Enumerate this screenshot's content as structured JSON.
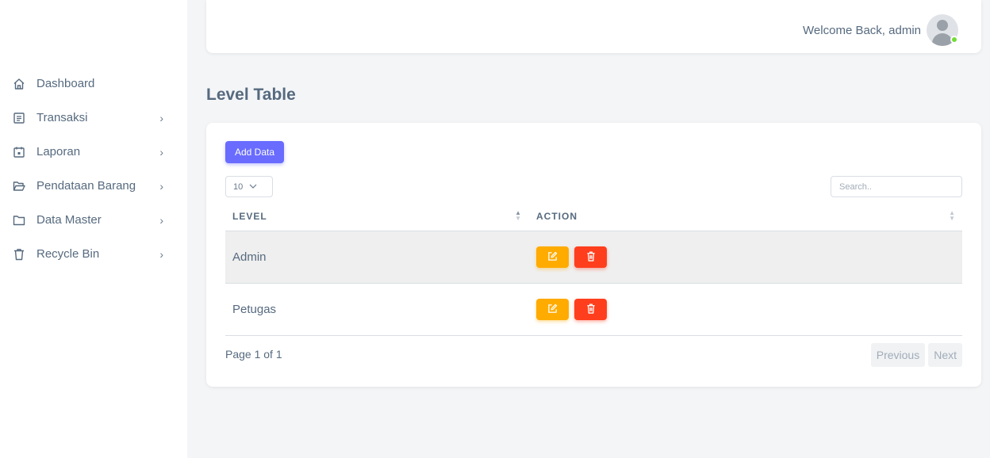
{
  "sidebar": {
    "items": [
      {
        "label": "Dashboard",
        "icon": "home-icon",
        "has_chevron": false
      },
      {
        "label": "Transaksi",
        "icon": "receipt-icon",
        "has_chevron": true
      },
      {
        "label": "Laporan",
        "icon": "calendar-icon",
        "has_chevron": true
      },
      {
        "label": "Pendataan Barang",
        "icon": "folder-open-icon",
        "has_chevron": true
      },
      {
        "label": "Data Master",
        "icon": "folder-icon",
        "has_chevron": true
      },
      {
        "label": "Recycle Bin",
        "icon": "trash-icon",
        "has_chevron": true
      }
    ],
    "chevron": "›"
  },
  "header": {
    "welcome": "Welcome Back, admin",
    "avatar_status_color": "#71dd37"
  },
  "page": {
    "title": "Level Table"
  },
  "table_controls": {
    "add_label": "Add Data",
    "page_size": "10",
    "search_placeholder": "Search.."
  },
  "table": {
    "columns": [
      "LEVEL",
      "ACTION"
    ],
    "rows": [
      {
        "level": "Admin"
      },
      {
        "level": "Petugas"
      }
    ]
  },
  "pagination": {
    "info": "Page 1 of 1",
    "previous": "Previous",
    "next": "Next"
  },
  "colors": {
    "primary": "#696cff",
    "warning": "#ffab00",
    "danger": "#ff3e1d"
  }
}
